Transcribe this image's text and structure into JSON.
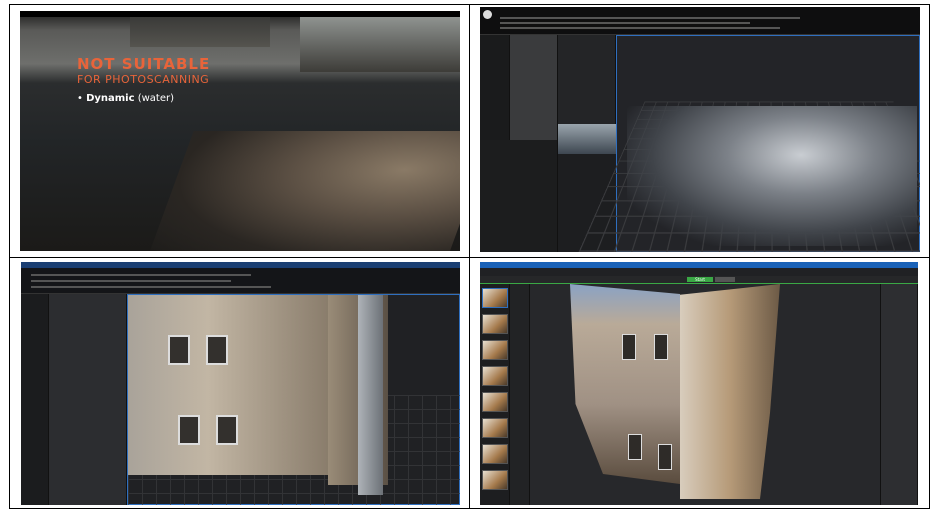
{
  "slide": {
    "title": "NOT SUITABLE",
    "subtitle": "FOR PHOTOSCANNING",
    "bullet_bold": "Dynamic",
    "bullet_rest": " (water)",
    "accent": "#e8643a"
  },
  "meshroom": {
    "start_label": "Start",
    "accent": "#3aa845"
  }
}
